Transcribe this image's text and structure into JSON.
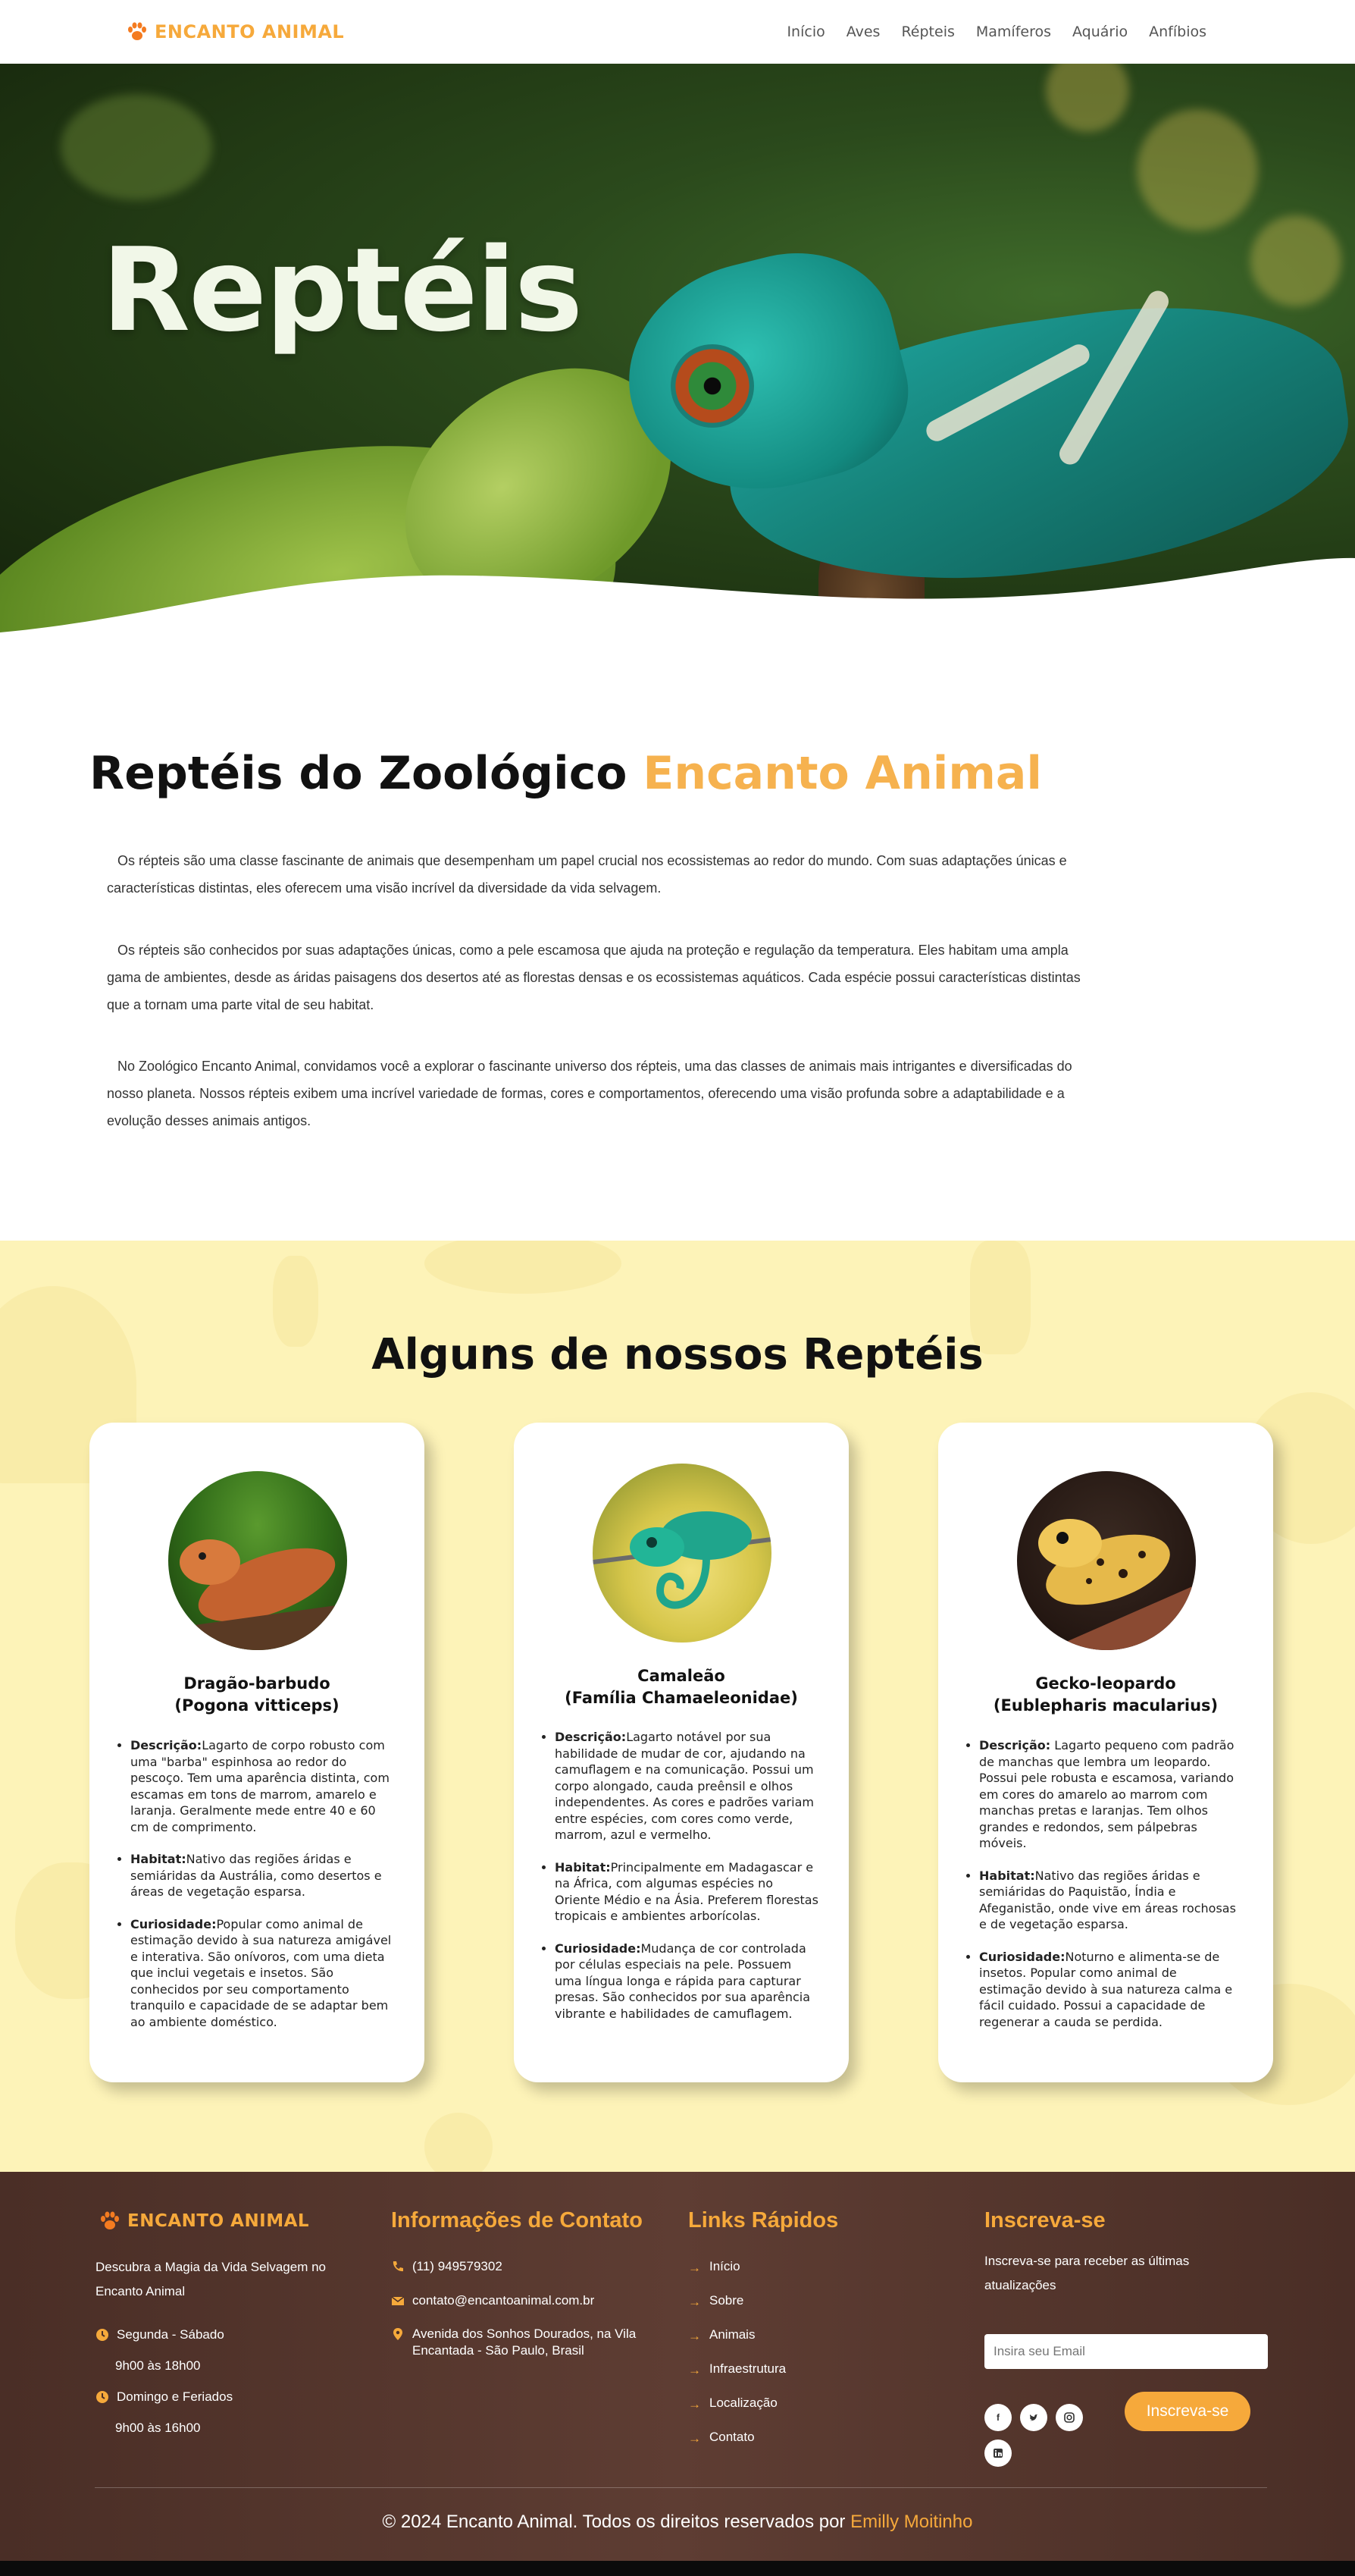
{
  "nav": {
    "logo_text": "ENCANTO ANIMAL",
    "links": [
      "Início",
      "Aves",
      "Répteis",
      "Mamíferos",
      "Aquário",
      "Anfíbios"
    ]
  },
  "hero": {
    "title": "Reptéis"
  },
  "intro": {
    "title_main": "Reptéis do Zoológico",
    "title_accent": "Encanto Animal",
    "paragraphs": [
      "Os répteis são uma classe fascinante de animais que desempenham um papel crucial nos ecossistemas ao redor do mundo. Com suas adaptações únicas e características distintas, eles oferecem uma visão incrível da diversidade da vida selvagem.",
      "Os répteis são conhecidos por suas adaptações únicas, como a pele escamosa que ajuda na proteção e regulação da temperatura. Eles habitam uma ampla gama de ambientes, desde as áridas paisagens dos desertos até as florestas densas e os ecossistemas aquáticos. Cada espécie possui características distintas que a tornam uma parte vital de seu habitat.",
      "No Zoológico Encanto Animal, convidamos você a explorar o fascinante universo dos répteis, uma das classes de animais mais intrigantes e diversificadas do nosso planeta. Nossos répteis exibem uma incrível variedade de formas, cores e comportamentos, oferecendo uma visão profunda sobre a adaptabilidade e a evolução desses animais antigos."
    ]
  },
  "reptiles": {
    "title": "Alguns de nossos Reptéis",
    "cards": [
      {
        "name": "Dragão-barbudo",
        "scientific": "(Pogona vitticeps)",
        "items": [
          {
            "label": "Descrição:",
            "text": "Lagarto de corpo robusto com uma \"barba\" espinhosa ao redor do pescoço. Tem uma aparência distinta, com escamas em tons de marrom, amarelo e laranja. Geralmente mede entre 40 e 60 cm de comprimento."
          },
          {
            "label": "Habitat:",
            "text": "Nativo das regiões áridas e semiáridas da Austrália, como desertos e áreas de vegetação esparsa."
          },
          {
            "label": "Curiosidade:",
            "text": "Popular como animal de estimação devido à sua natureza amigável e interativa. São onívoros, com uma dieta que inclui vegetais e insetos. São conhecidos por seu comportamento tranquilo e capacidade de se adaptar bem ao ambiente doméstico."
          }
        ]
      },
      {
        "name": "Camaleão",
        "scientific": "(Família Chamaeleonidae)",
        "items": [
          {
            "label": "Descrição:",
            "text": "Lagarto notável por sua habilidade de mudar de cor, ajudando na camuflagem e na comunicação. Possui um corpo alongado, cauda preênsil e olhos independentes. As cores e padrões variam entre espécies, com cores como verde, marrom, azul e vermelho."
          },
          {
            "label": "Habitat:",
            "text": "Principalmente em Madagascar e na África, com algumas espécies no Oriente Médio e na Ásia. Preferem florestas tropicais e ambientes arborícolas."
          },
          {
            "label": "Curiosidade:",
            "text": "Mudança de cor controlada por células especiais na pele. Possuem uma língua longa e rápida para capturar presas. São conhecidos por sua aparência vibrante e habilidades de camuflagem."
          }
        ]
      },
      {
        "name": "Gecko-leopardo",
        "scientific": "(Eublepharis macularius)",
        "items": [
          {
            "label": "Descrição:",
            "text": " Lagarto pequeno com padrão de manchas que lembra um leopardo. Possui pele robusta e escamosa, variando em cores do amarelo ao marrom com manchas pretas e laranjas. Tem olhos grandes e redondos, sem pálpebras móveis."
          },
          {
            "label": "Habitat:",
            "text": "Nativo das regiões áridas e semiáridas do Paquistão, Índia e Afeganistão, onde vive em áreas rochosas e de vegetação esparsa."
          },
          {
            "label": "Curiosidade:",
            "text": "Noturno e alimenta-se de insetos. Popular como animal de estimação devido à sua natureza calma e fácil cuidado. Possui a capacidade de regenerar a cauda se perdida."
          }
        ]
      }
    ]
  },
  "footer": {
    "logo_text": "ENCANTO ANIMAL",
    "description": "Descubra a Magia da Vida Selvagem no Encanto Animal",
    "hours": [
      {
        "days": "Segunda - Sábado",
        "time": "9h00 às 18h00"
      },
      {
        "days": "Domingo e Feriados",
        "time": "9h00 às 16h00"
      }
    ],
    "contact_title": "Informações de Contato",
    "phone": "(11) 949579302",
    "email": "contato@encantoanimal.com.br",
    "address": "Avenida dos Sonhos Dourados, na Vila Encantada - São Paulo, Brasil",
    "links_title": "Links Rápidos",
    "links": [
      "Início",
      "Sobre",
      "Animais",
      "Infraestrutura",
      "Localização",
      "Contato"
    ],
    "subscribe_title": "Inscreva-se",
    "subscribe_text": "Inscreva-se para receber as últimas atualizações",
    "email_placeholder": "Insira seu Email",
    "subscribe_button": "Inscreva-se",
    "social": [
      "facebook-icon",
      "twitter-icon",
      "instagram-icon",
      "linkedin-icon"
    ],
    "copyright": "© 2024 Encanto Animal. Todos os direitos reservados por",
    "author": "Emilly Moitinho"
  },
  "colors": {
    "accent": "#f6a93b",
    "section_bg": "#fdf3b8",
    "footer_bg": "#5a3a31"
  }
}
